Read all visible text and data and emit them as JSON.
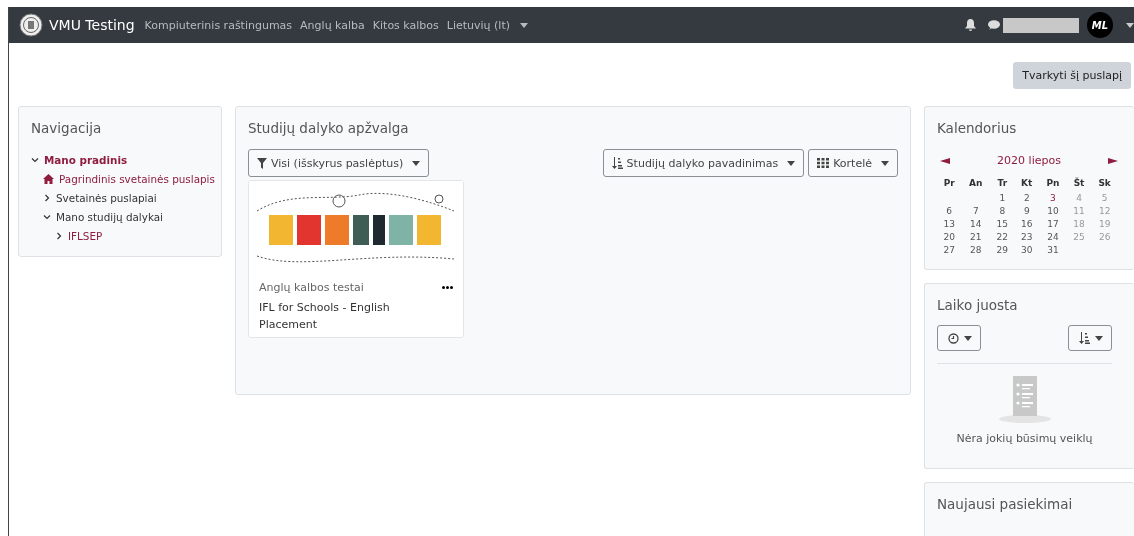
{
  "navbar": {
    "brand": "VMU Testing",
    "links": [
      {
        "label": "Kompiuterinis raštingumas",
        "dropdown": false
      },
      {
        "label": "Anglų kalba",
        "dropdown": false
      },
      {
        "label": "Kitos kalbos",
        "dropdown": false
      },
      {
        "label": "Lietuvių (lt)",
        "dropdown": true
      }
    ],
    "avatar": "ML"
  },
  "page_button": "Tvarkyti šį puslapį",
  "navigation": {
    "title": "Navigacija",
    "items": [
      {
        "label": "Mano pradinis",
        "kind": "root",
        "expanded": true,
        "children": [
          {
            "label": "Pagrindinis svetainės puslapis",
            "kind": "home"
          },
          {
            "label": "Svetainės puslapiai",
            "kind": "branch",
            "expanded": false
          },
          {
            "label": "Mano studijų dalykai",
            "kind": "branch",
            "expanded": true,
            "children": [
              {
                "label": "IFLSEP",
                "kind": "link",
                "expanded": false
              }
            ]
          }
        ]
      }
    ]
  },
  "overview": {
    "title": "Studijų dalyko apžvalga",
    "filter": "Visi (išskyrus paslėptus)",
    "sort": "Studijų dalyko pavadinimas",
    "view": "Kortelė",
    "courses": [
      {
        "category": "Anglų kalbos testai",
        "name": "IFL for Schools - English Placement"
      }
    ]
  },
  "calendar": {
    "title": "Kalendorius",
    "month": "2020 liepos",
    "weekdays": [
      "Pr",
      "An",
      "Tr",
      "Kt",
      "Pn",
      "Št",
      "Sk"
    ],
    "weeks": [
      {
        "starts_mid_week": true,
        "days": [
          {
            "day": "1",
            "event": false
          },
          {
            "day": "2",
            "event": false
          },
          {
            "day": "3",
            "event": true
          },
          {
            "day": "4",
            "event": false
          },
          {
            "day": "5",
            "event": false
          }
        ]
      },
      {
        "days": [
          {
            "day": "6",
            "event": false
          },
          {
            "day": "7",
            "event": false
          },
          {
            "day": "8",
            "event": false
          },
          {
            "day": "9",
            "event": false
          },
          {
            "day": "10",
            "event": false
          },
          {
            "day": "11",
            "event": false
          },
          {
            "day": "12",
            "event": false
          }
        ]
      },
      {
        "days": [
          {
            "day": "13",
            "event": false
          },
          {
            "day": "14",
            "event": false
          },
          {
            "day": "15",
            "event": false
          },
          {
            "day": "16",
            "event": false
          },
          {
            "day": "17",
            "event": false
          },
          {
            "day": "18",
            "event": false
          },
          {
            "day": "19",
            "event": false
          }
        ]
      },
      {
        "days": [
          {
            "day": "20",
            "event": false
          },
          {
            "day": "21",
            "event": false
          },
          {
            "day": "22",
            "event": false
          },
          {
            "day": "23",
            "event": false
          },
          {
            "day": "24",
            "event": false
          },
          {
            "day": "25",
            "event": false
          },
          {
            "day": "26",
            "event": false
          }
        ]
      },
      {
        "starts_mid_week": false,
        "days": [
          {
            "day": "27",
            "event": false
          },
          {
            "day": "28",
            "event": false
          },
          {
            "day": "29",
            "event": false
          },
          {
            "day": "30",
            "event": false
          },
          {
            "day": "31",
            "event": false
          }
        ]
      }
    ]
  },
  "timeline": {
    "title": "Laiko juosta",
    "empty_text": "Nėra jokių būsimų veiklų"
  },
  "achievements": {
    "title": "Naujausi pasiekimai"
  }
}
